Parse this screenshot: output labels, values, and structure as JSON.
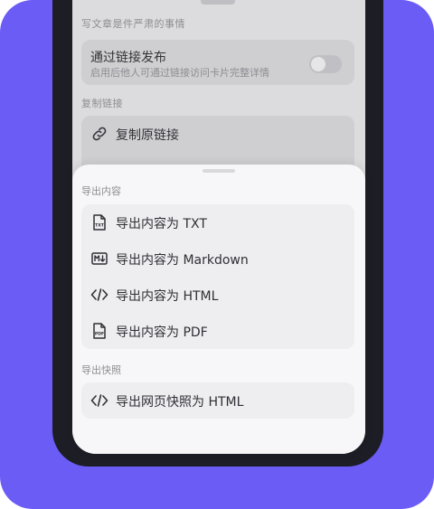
{
  "background": {
    "section_caption_1": "写文章是件严肃的事情",
    "link_publish": {
      "title": "通过链接发布",
      "subtitle": "启用后他人可通过链接访问卡片完整详情",
      "enabled": false
    },
    "section_caption_2": "复制链接",
    "copy_original_link": "复制原链接"
  },
  "sheet": {
    "export_content_caption": "导出内容",
    "export_items": [
      {
        "label": "导出内容为 TXT",
        "icon": "txt-file-icon"
      },
      {
        "label": "导出内容为 Markdown",
        "icon": "markdown-icon"
      },
      {
        "label": "导出内容为 HTML",
        "icon": "code-icon"
      },
      {
        "label": "导出内容为 PDF",
        "icon": "pdf-file-icon"
      }
    ],
    "export_snapshot_caption": "导出快照",
    "snapshot_items": [
      {
        "label": "导出网页快照为 HTML",
        "icon": "code-icon"
      }
    ]
  },
  "colors": {
    "accent_background": "#6b5cf6",
    "phone_frame": "#1d1d25",
    "sheet": "#f7f7f9"
  }
}
